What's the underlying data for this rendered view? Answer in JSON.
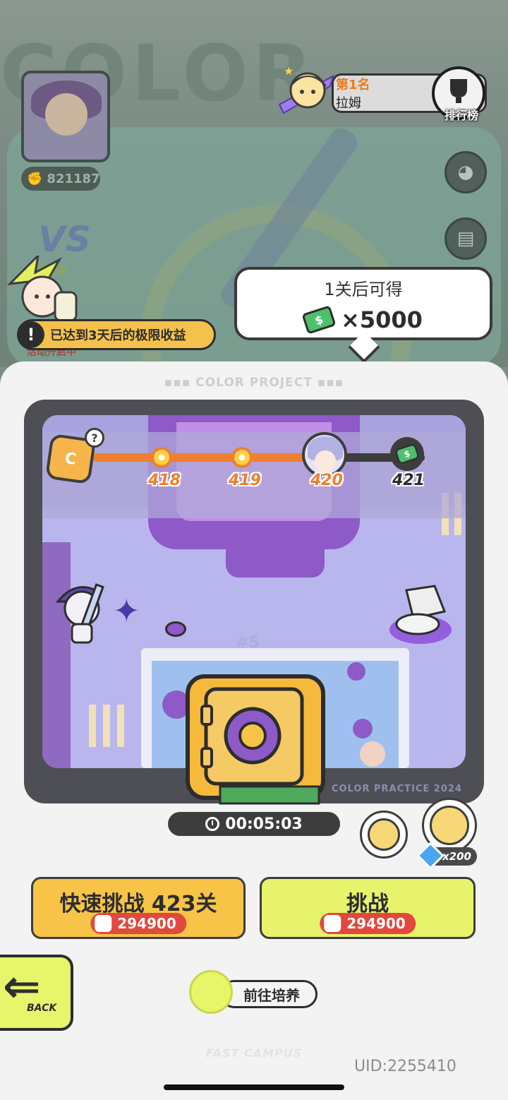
{
  "background": {
    "title_word": "COLOR",
    "player_score": "821187",
    "vs_status": "进行中",
    "vs_sub_status": "活动开启中",
    "rank_title": "第1名",
    "rank_name": "拉姆",
    "rank_button_label": "排行榜"
  },
  "reward_popup": {
    "title": "1关后可得",
    "amount": "×5000",
    "currency_icon": "cash-icon"
  },
  "limit_notice": {
    "text": "已达到3天后的极限收益",
    "icon": "!"
  },
  "panel": {
    "header": "COLOR PROJECT",
    "footer_tag": "COLOR PRACTICE 2024",
    "campus_label": "FAST CAMPUS"
  },
  "stage_progress": {
    "nodes": [
      {
        "label": "418",
        "type": "cleared"
      },
      {
        "label": "419",
        "type": "cleared"
      },
      {
        "label": "420",
        "type": "boss"
      },
      {
        "label": "421",
        "type": "reward"
      }
    ],
    "help_symbol": "?",
    "box_symbol": "C"
  },
  "scene": {
    "ghost_tag": "#5"
  },
  "timer": {
    "value": "00:05:03"
  },
  "speedup": {
    "diamond_cost": "x200"
  },
  "buttons": {
    "quick_challenge": {
      "label": "快速挑战 423关",
      "cost": "294900"
    },
    "challenge": {
      "label": "挑战",
      "cost": "294900"
    },
    "back_label": "BACK",
    "train_label": "前往培养"
  },
  "uid": "UID:2255410",
  "colors": {
    "accent_yellow": "#f7c447",
    "accent_lime": "#e7f36a",
    "progress_orange": "#f07f2e",
    "cost_red": "#e2483d"
  }
}
